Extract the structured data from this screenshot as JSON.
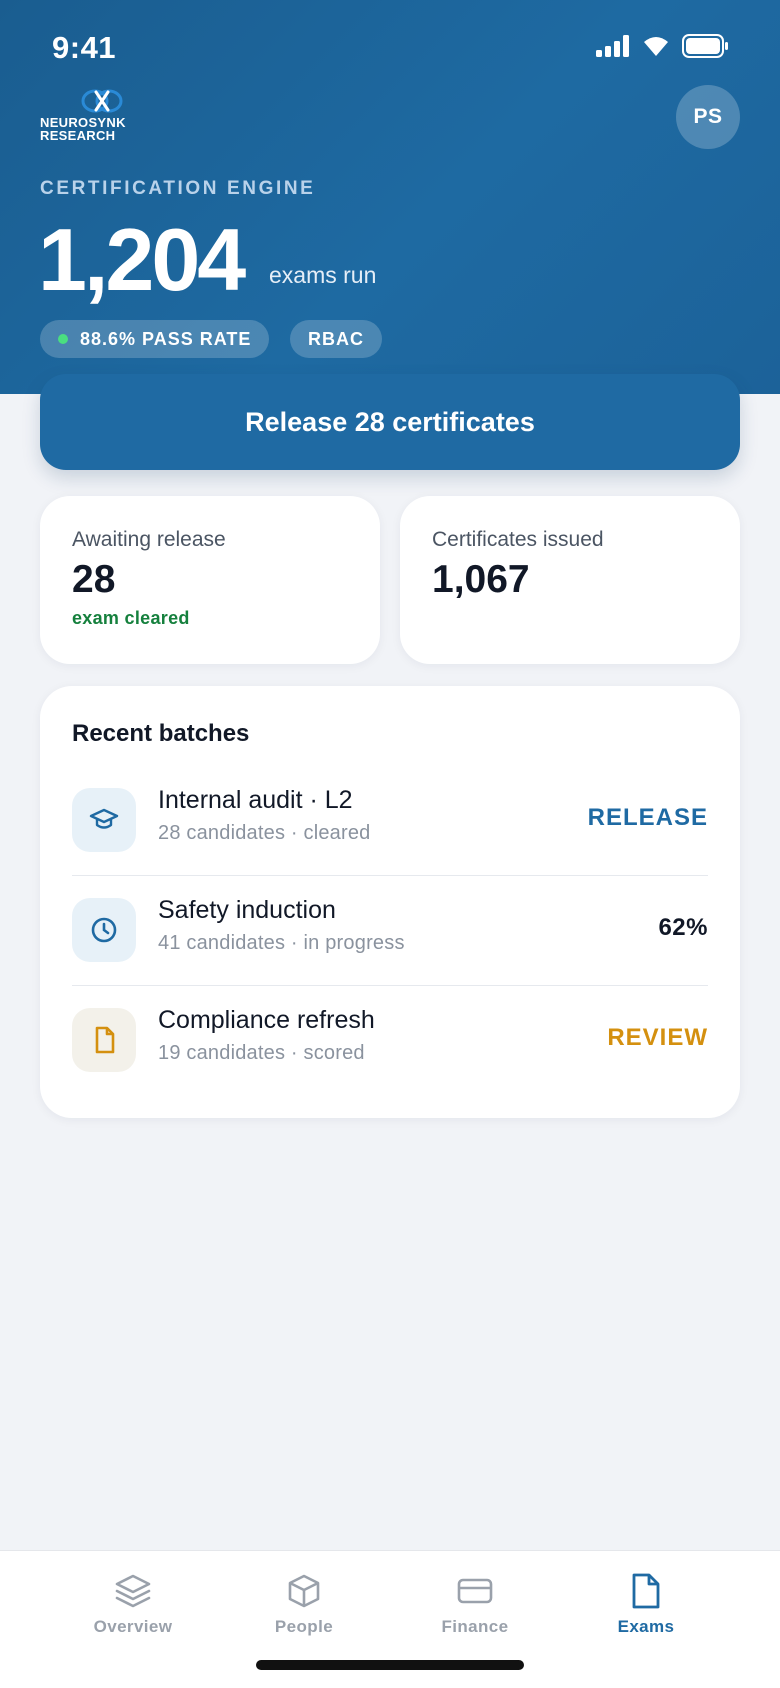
{
  "status_bar": {
    "time": "9:41"
  },
  "header": {
    "logo_lines": [
      "NEUROSYNK",
      "RESEARCH"
    ],
    "avatar_initials": "PS",
    "eyebrow": "CERTIFICATION ENGINE",
    "exams_count": "1,204",
    "exams_unit": "exams run",
    "pills": [
      {
        "label": "88.6% PASS RATE",
        "dot_color": "#4ade80"
      },
      {
        "label": "RBAC"
      }
    ]
  },
  "primary_action": {
    "label": "Release 28 certificates"
  },
  "stats": [
    {
      "label": "Awaiting release",
      "value": "28",
      "sub": "exam cleared"
    },
    {
      "label": "Certificates issued",
      "value": "1,067"
    }
  ],
  "recent_batches": {
    "title": "Recent batches",
    "items": [
      {
        "name": "Internal audit · L2",
        "meta": "28 candidates · cleared",
        "action": "RELEASE",
        "icon": "graduation-cap-icon",
        "action_color": "#1f6aa3"
      },
      {
        "name": "Safety induction",
        "meta": "41 candidates · in progress",
        "action": "62%",
        "icon": "clock-icon",
        "action_color": "#111827"
      },
      {
        "name": "Compliance refresh",
        "meta": "19 candidates · scored",
        "action": "REVIEW",
        "icon": "document-icon",
        "action_color": "#d4900f"
      }
    ]
  },
  "tabbar": {
    "tabs": [
      {
        "label": "Overview",
        "icon": "layers-icon",
        "active": false
      },
      {
        "label": "People",
        "icon": "cube-icon",
        "active": false
      },
      {
        "label": "Finance",
        "icon": "card-icon",
        "active": false
      },
      {
        "label": "Exams",
        "icon": "document-icon",
        "active": true
      }
    ]
  },
  "colors": {
    "brand": "#1f6aa3",
    "success": "#15803d",
    "warning": "#d4900f"
  }
}
